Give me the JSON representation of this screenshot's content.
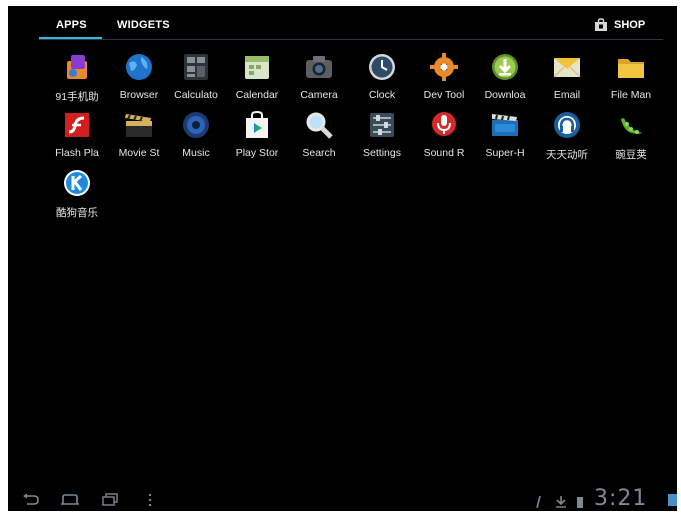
{
  "tabs": {
    "apps": "APPS",
    "widgets": "WIDGETS",
    "shop": "SHOP"
  },
  "apps": [
    {
      "label": "91手机助",
      "icon": "phone-assistant-icon"
    },
    {
      "label": "Browser",
      "icon": "globe-icon"
    },
    {
      "label": "Calculato",
      "icon": "calculator-icon"
    },
    {
      "label": "Calendar",
      "icon": "calendar-icon"
    },
    {
      "label": "Camera",
      "icon": "camera-icon"
    },
    {
      "label": "Clock",
      "icon": "clock-icon"
    },
    {
      "label": "Dev Tool",
      "icon": "gear-icon"
    },
    {
      "label": "Downloa",
      "icon": "download-icon"
    },
    {
      "label": "Email",
      "icon": "envelope-icon"
    },
    {
      "label": "File Man",
      "icon": "folder-icon"
    },
    {
      "label": "Flash Pla",
      "icon": "flash-player-icon"
    },
    {
      "label": "Movie St",
      "icon": "clapperboard-icon"
    },
    {
      "label": "Music",
      "icon": "speaker-icon"
    },
    {
      "label": "Play Stor",
      "icon": "shopping-bag-icon"
    },
    {
      "label": "Search",
      "icon": "magnifier-icon"
    },
    {
      "label": "Settings",
      "icon": "settings-sliders-icon"
    },
    {
      "label": "Sound R",
      "icon": "microphone-icon"
    },
    {
      "label": "Super-H",
      "icon": "video-clapper-icon"
    },
    {
      "label": "天天动听",
      "icon": "headphones-icon"
    },
    {
      "label": "豌豆荚",
      "icon": "pea-pod-icon"
    },
    {
      "label": "酷狗音乐",
      "icon": "kugou-k-icon"
    }
  ],
  "status": {
    "time": "3:21"
  },
  "colors": {
    "accent": "#33b5e5",
    "background": "#000000",
    "clock": "#7d8a93"
  }
}
